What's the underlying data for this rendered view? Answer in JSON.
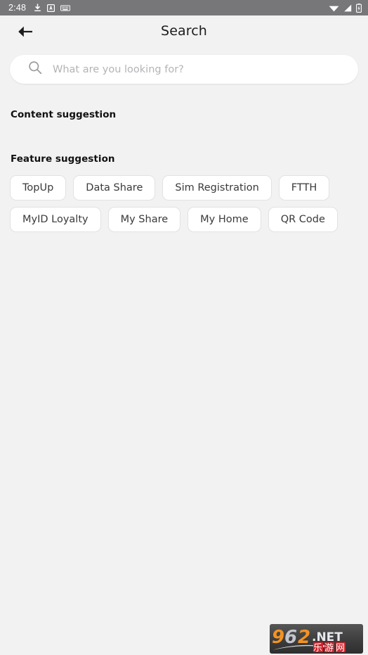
{
  "status_bar": {
    "clock": "2:48",
    "left_icons": [
      "download-icon",
      "translate-a-icon",
      "keyboard-icon"
    ],
    "right_icons": [
      "wifi-icon",
      "cellular-signal-icon",
      "battery-charging-icon"
    ],
    "background_color": "#77777a",
    "foreground_color": "#ffffff"
  },
  "app_bar": {
    "back_icon": "arrow-left-icon",
    "title": "Search"
  },
  "search": {
    "icon": "search-icon",
    "value": "",
    "placeholder": "What are you looking for?"
  },
  "sections": {
    "content_suggestion": {
      "title": "Content suggestion",
      "items": []
    },
    "feature_suggestion": {
      "title": "Feature suggestion",
      "rows": [
        [
          "TopUp",
          "Data Share",
          "Sim Registration",
          "FTTH"
        ],
        [
          "MyID Loyalty",
          "My Share",
          "My Home",
          "QR Code"
        ]
      ]
    }
  },
  "chips": {
    "r0c0": "TopUp",
    "r0c1": "Data Share",
    "r0c2": "Sim Registration",
    "r0c3": "FTTH",
    "r1c0": "MyID Loyalty",
    "r1c1": "My Share",
    "r1c2": "My Home",
    "r1c3": "QR Code"
  },
  "watermark": {
    "digits": "962",
    "suffix": ".NET",
    "chinese": "乐游网",
    "orange": "#f39323",
    "silver": "#c9ccd1",
    "red": "#d2222a"
  },
  "theme": {
    "page_background": "#f2f2f2",
    "card_background": "#ffffff",
    "chip_border": "#e2e2e4",
    "text_primary": "#111113",
    "text_secondary": "#3a3a3c",
    "placeholder": "#b4b4b8"
  }
}
